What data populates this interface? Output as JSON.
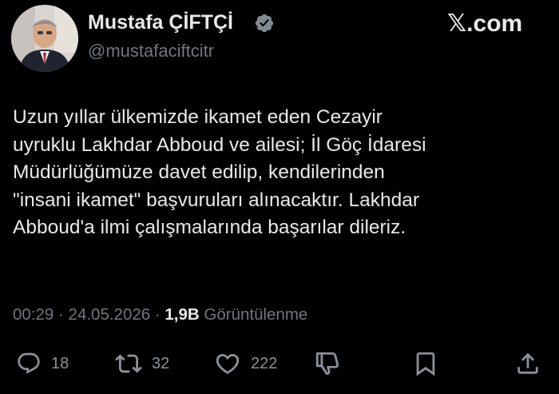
{
  "author": {
    "display_name": "Mustafa ÇİFTÇİ",
    "handle": "@mustafaciftcitr",
    "verified_icon": "verified-badge-icon"
  },
  "site": {
    "mark": "𝕏.com"
  },
  "tweet": {
    "lines": [
      "Uzun yıllar ülkemizde ikamet eden Cezayir",
      "uyruklu Lakhdar Abboud ve ailesi; İl Göç İdaresi",
      "Müdürlüğümüze davet edilip, kendilerinden",
      "\"insani ikamet\" başvuruları alınacaktır. Lakhdar",
      "Abboud'a ilmi çalışmalarında başarılar dileriz."
    ]
  },
  "meta": {
    "time": "00:29",
    "separator": "·",
    "date": "24.05.2026",
    "views_count": "1,9B",
    "views_label": "Görüntülenme"
  },
  "actions": {
    "replies": "18",
    "reposts": "32",
    "likes": "222"
  },
  "colors": {
    "background": "#000000",
    "text": "#e7e9ea",
    "secondary": "#71767b",
    "verified": "#828a91"
  }
}
